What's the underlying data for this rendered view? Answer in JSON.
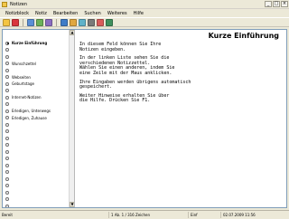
{
  "window": {
    "title": "Notizen",
    "controls": [
      "_",
      "□",
      "×"
    ]
  },
  "menu": [
    "Notizblock",
    "Notiz",
    "Bearbeiten",
    "Suchen",
    "Weiteres",
    "Hilfe"
  ],
  "toolbar_colors": [
    "#f4c542",
    "#d9363e",
    "#5a8fd6",
    "#6bb15a",
    "#8b6cc1",
    "#3e7cc7",
    "#e0a73f",
    "#5fb2c9",
    "#7a7a7a",
    "#d95b5b",
    "#3f8f5d",
    "#b88a3a",
    "#6f6bd1"
  ],
  "sidebar": {
    "items": [
      {
        "label": "Kurze Einführung",
        "active": true
      },
      {
        "label": ""
      },
      {
        "label": ""
      },
      {
        "label": "Wunschzettel"
      },
      {
        "label": ""
      },
      {
        "label": "Webseiten"
      },
      {
        "label": "Geburtstage"
      },
      {
        "label": ""
      },
      {
        "label": "Internet-Notizen"
      },
      {
        "label": ""
      },
      {
        "label": "Erledigen, Unterwegs"
      },
      {
        "label": "Erledigen, Zuhause"
      },
      {
        "label": ""
      },
      {
        "label": ""
      },
      {
        "label": ""
      },
      {
        "label": ""
      },
      {
        "label": ""
      },
      {
        "label": ""
      },
      {
        "label": ""
      },
      {
        "label": ""
      },
      {
        "label": ""
      },
      {
        "label": ""
      },
      {
        "label": ""
      },
      {
        "label": ""
      },
      {
        "label": ""
      },
      {
        "label": ""
      }
    ]
  },
  "note": {
    "title": "Kurze Einführung",
    "paragraphs": [
      "In diesem Feld können Sie Ihre\nNotizen eingeben.",
      "In der linken Liste sehen Sie die\nverschiedenen Notizzettel.\nWählen Sie einen anderen, indem Sie\neine Zeile mit der Maus anklicken.",
      "Ihre Eingaben werden übrigens automatisch\ngespeichert.",
      "Weiter Hinweise erhalten Sie über\ndie Hilfe. Drücken Sie F1."
    ]
  },
  "status": {
    "ready": "Bereit",
    "position": "1 Ab. 1 / 316 Zeichen",
    "mode": "Einf",
    "datetime": "02.07.2009  11:56"
  }
}
